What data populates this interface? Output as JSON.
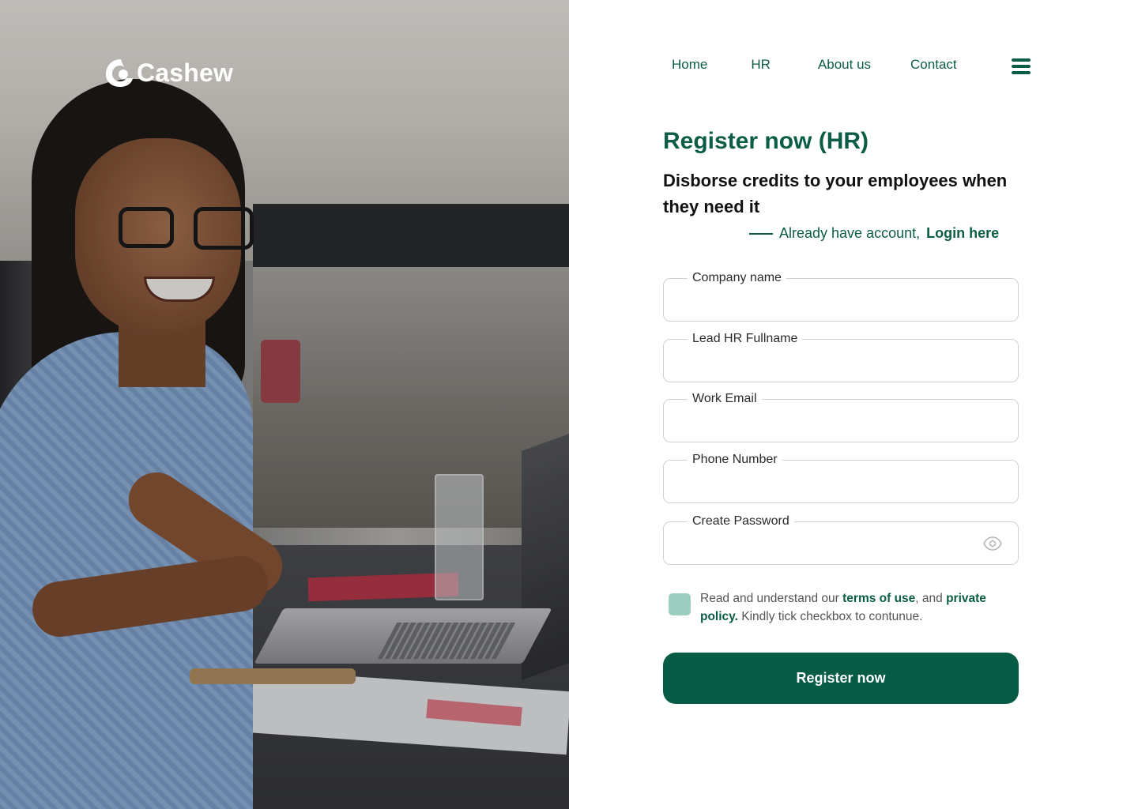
{
  "brand": {
    "name": "Cashew"
  },
  "nav": {
    "items": [
      {
        "label": "Home"
      },
      {
        "label": "HR"
      },
      {
        "label": "About us"
      },
      {
        "label": "Contact"
      }
    ]
  },
  "form": {
    "title": "Register now (HR)",
    "subtitle": "Disborse credits to your employees when they need it",
    "login_prompt": "Already have account,",
    "login_link": "Login here",
    "fields": [
      {
        "label": "Company name",
        "value": ""
      },
      {
        "label": "Lead HR Fullname",
        "value": ""
      },
      {
        "label": "Work Email",
        "value": ""
      },
      {
        "label": "Phone Number",
        "value": ""
      },
      {
        "label": "Create Password",
        "value": ""
      }
    ],
    "terms": {
      "prefix": "Read and understand our",
      "terms_link": "terms of use",
      "middle": ", and",
      "privacy_link": "private policy.",
      "suffix": "Kindly tick checkbox to contunue."
    },
    "submit_label": "Register now"
  },
  "colors": {
    "primary": "#075c45",
    "checkbox": "#9ccfc0",
    "border": "#cfd2d4"
  },
  "icons": {
    "menu": "hamburger-menu-icon",
    "password_toggle": "eye-icon",
    "logo": "cashew-logo-icon"
  }
}
